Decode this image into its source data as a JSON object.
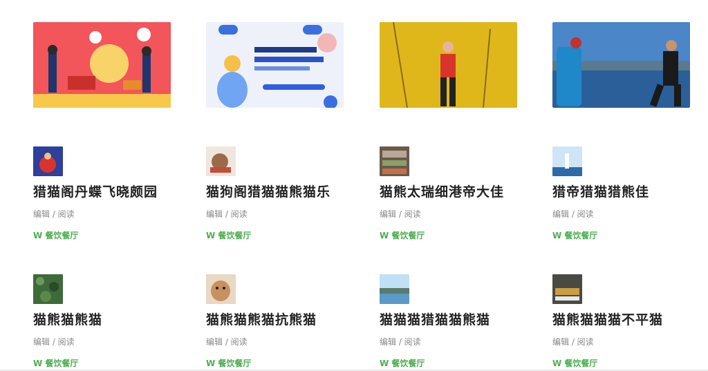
{
  "banners": [
    {
      "name": "banner-festival",
      "colors": [
        "#f2555a",
        "#f7c94a"
      ]
    },
    {
      "name": "banner-promo",
      "colors": [
        "#f0f2fa",
        "#3a6fe0"
      ]
    },
    {
      "name": "banner-runner-yellow",
      "colors": [
        "#e8c21c",
        "#d9342b"
      ]
    },
    {
      "name": "banner-hikers-lake",
      "colors": [
        "#4a7fbf",
        "#1f3a5a"
      ]
    }
  ],
  "cards": [
    {
      "title": "猎猫阁丹蝶飞晓颇园",
      "meta": "编辑 / 阅读",
      "tag": "W 餐饮餐厅",
      "thumb_color": "#2e3f9c"
    },
    {
      "title": "猫狗阁猎猫猫熊猫乐",
      "meta": "编辑 / 阅读",
      "tag": "W 餐饮餐厅",
      "thumb_color": "#9a6a4a"
    },
    {
      "title": "猫熊太瑞细港帝大佳",
      "meta": "编辑 / 阅读",
      "tag": "W 餐饮餐厅",
      "thumb_color": "#6a5a4a"
    },
    {
      "title": "猎帝猎猫猎熊佳",
      "meta": "编辑 / 阅读",
      "tag": "W 餐饮餐厅",
      "thumb_color": "#7fb3e0"
    },
    {
      "title": "猫熊猫熊猫",
      "meta": "编辑 / 阅读",
      "tag": "W 餐饮餐厅",
      "thumb_color": "#3f6a3a"
    },
    {
      "title": "猫熊猫熊猫抗熊猫",
      "meta": "编辑 / 阅读",
      "tag": "W 餐饮餐厅",
      "thumb_color": "#c89060"
    },
    {
      "title": "猫猫猫猎猫猫熊猫",
      "meta": "编辑 / 阅读",
      "tag": "W 餐饮餐厅",
      "thumb_color": "#5a9ac8"
    },
    {
      "title": "猫熊猫猫猫不平猫",
      "meta": "编辑 / 阅读",
      "tag": "W 餐饮餐厅",
      "thumb_color": "#4a4a44"
    }
  ]
}
